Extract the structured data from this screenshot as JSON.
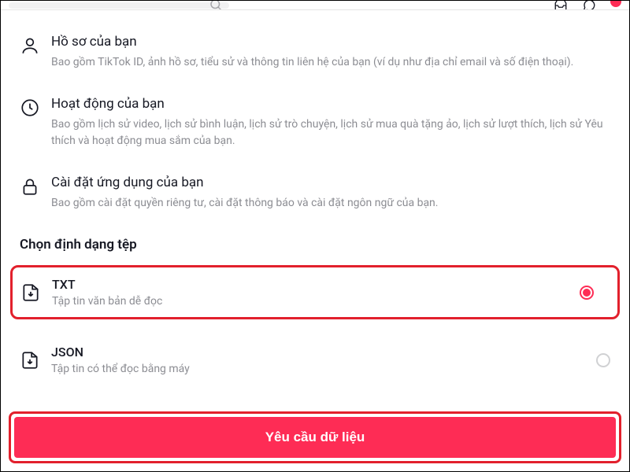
{
  "info_sections": [
    {
      "title": "Hồ sơ của bạn",
      "desc": "Bao gồm TikTok ID, ảnh hồ sơ, tiểu sử và thông tin liên hệ của bạn (ví dụ như địa chỉ email và số điện thoại)."
    },
    {
      "title": "Hoạt động của bạn",
      "desc": "Bao gồm lịch sử video, lịch sử bình luận, lịch sử trò chuyện, lịch sử mua quà tặng ảo, lịch sử lượt thích, lịch sử Yêu thích và hoạt động mua sắm của bạn."
    },
    {
      "title": "Cài đặt ứng dụng của bạn",
      "desc": "Bao gồm cài đặt quyền riêng tư, cài đặt thông báo và cài đặt ngôn ngữ của bạn."
    }
  ],
  "format_header": "Chọn định dạng tệp",
  "formats": [
    {
      "title": "TXT",
      "desc": "Tập tin văn bản dễ đọc",
      "selected": true
    },
    {
      "title": "JSON",
      "desc": "Tập tin có thể đọc bằng máy",
      "selected": false
    }
  ],
  "request_label": "Yêu cầu dữ liệu"
}
